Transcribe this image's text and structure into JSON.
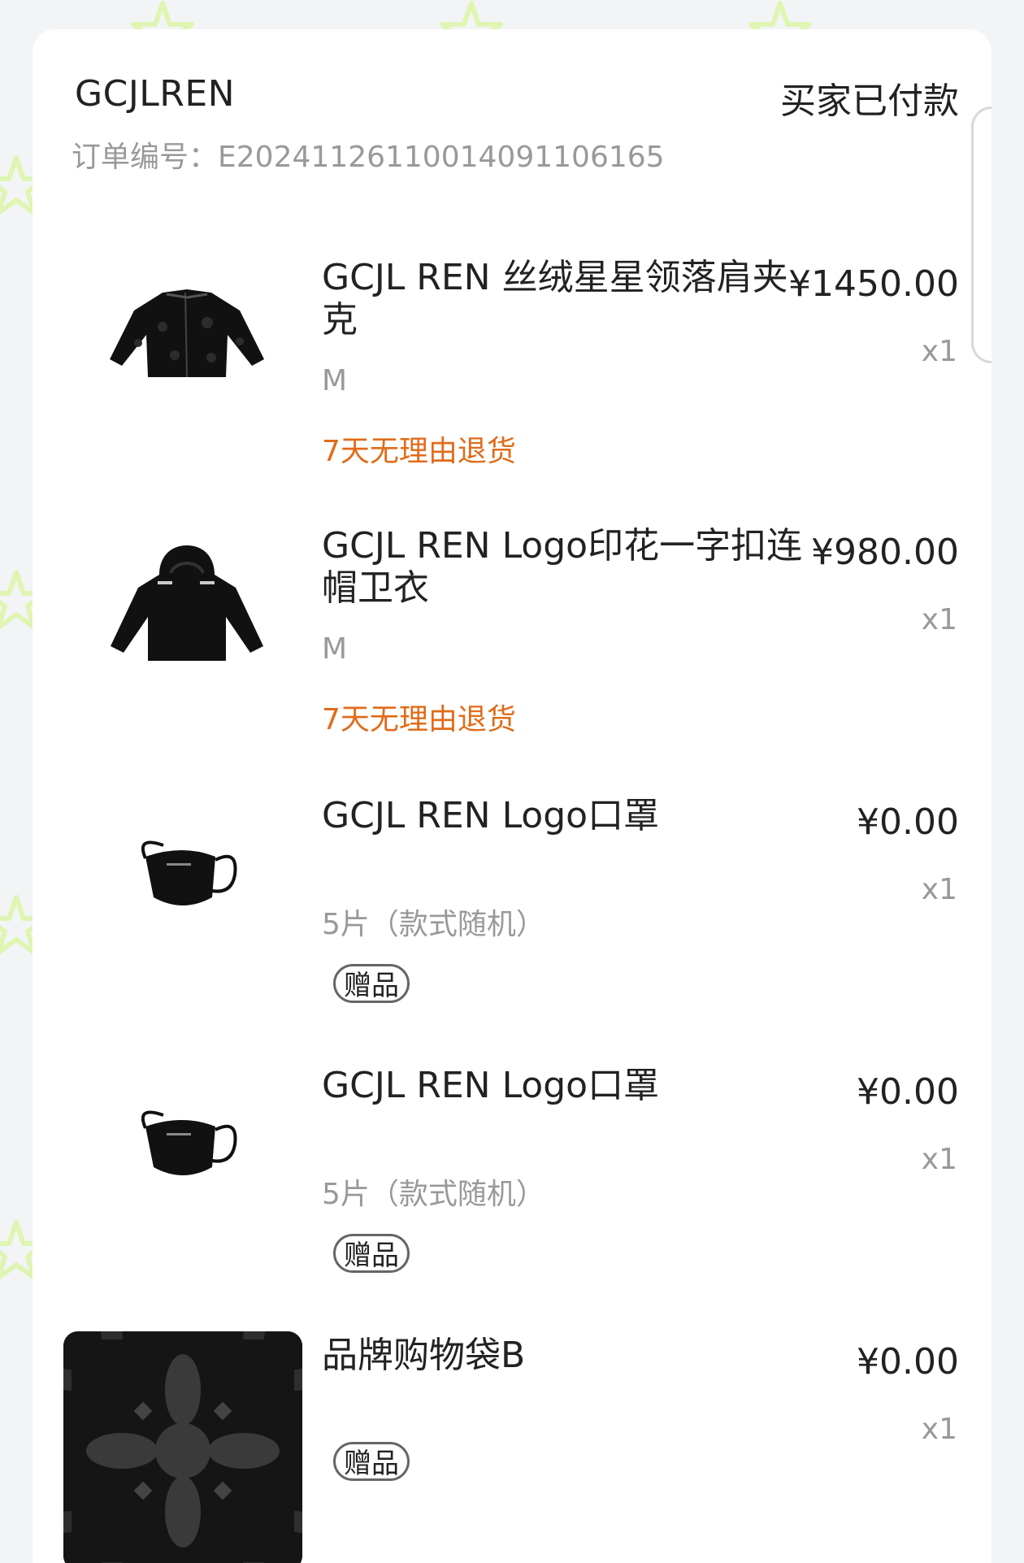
{
  "shop": {
    "name": "GCJLREN",
    "status": "买家已付款",
    "order_label": "订单编号：",
    "order_number": "E20241126110014091106165"
  },
  "items": [
    {
      "title": "GCJL REN 丝绒星星领落肩夹克",
      "price": "¥1450.00",
      "qty": "x1",
      "spec": "M",
      "tag": "7天无理由退货",
      "image": "black-velvet-jacket"
    },
    {
      "title": "GCJL REN Logo印花一字扣连帽卫衣",
      "price": "¥980.00",
      "qty": "x1",
      "spec": "M",
      "tag": "7天无理由退货",
      "image": "black-hoodie"
    },
    {
      "title": "GCJL REN Logo口罩",
      "price": "¥0.00",
      "qty": "x1",
      "spec": "5片（款式随机）",
      "tag": "赠品",
      "image": "black-mask"
    },
    {
      "title": "GCJL REN Logo口罩",
      "price": "¥0.00",
      "qty": "x1",
      "spec": "5片（款式随机）",
      "tag": "赠品",
      "image": "black-mask"
    },
    {
      "title": "品牌购物袋B",
      "price": "¥0.00",
      "qty": "x1",
      "tag": "赠品",
      "image": "pattern-shopping-bag"
    }
  ],
  "colors": {
    "background": "#f3f4f6",
    "card": "#ffffff",
    "text": "#222222",
    "muted": "#999999",
    "accent_orange": "#e06c1a",
    "watermark": "#d9f5a0"
  }
}
